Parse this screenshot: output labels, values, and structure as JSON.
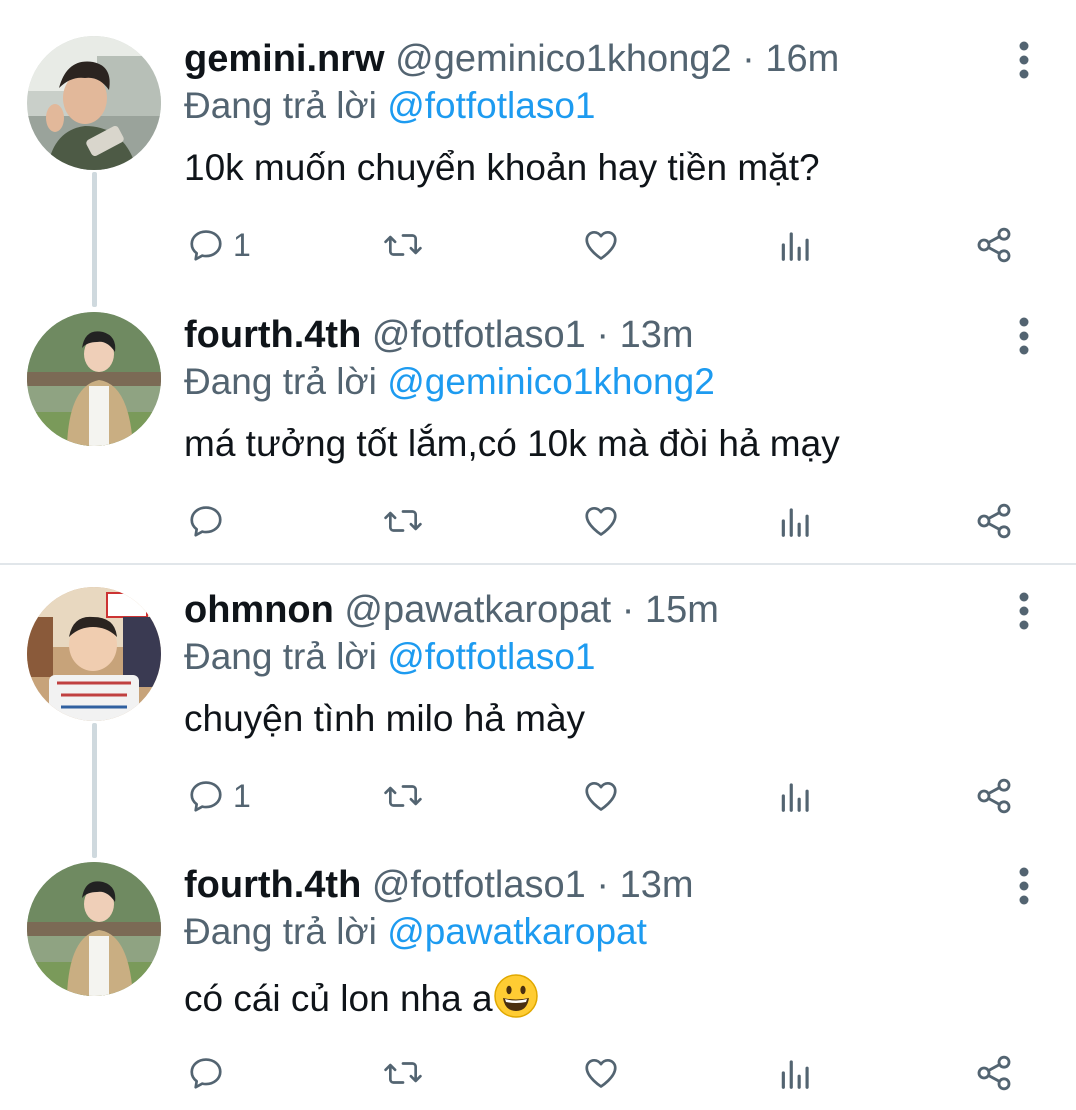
{
  "colors": {
    "text_primary": "#0f1419",
    "text_secondary": "#536471",
    "mention": "#1d9bf0",
    "thread_line": "#cfd9de",
    "divider": "#e1e6ea"
  },
  "reply_prefix": "Đang trả lời",
  "separator": "·",
  "tweets": [
    {
      "display_name": "gemini.nrw",
      "handle": "@geminico1khong2",
      "time": "16m",
      "replying_to": "@fotfotlaso1",
      "text": "10k muốn chuyển khoản hay tiền mặt?",
      "reply_count": "1",
      "avatar_icon": "profile-photo-gemini"
    },
    {
      "display_name": "fourth.4th",
      "handle": "@fotfotlaso1",
      "time": "13m",
      "replying_to": "@geminico1khong2",
      "text": "má tưởng tốt lắm,có 10k mà đòi hả mạy",
      "reply_count": "",
      "avatar_icon": "profile-photo-fourth"
    },
    {
      "display_name": "ohmnon",
      "handle": "@pawatkaropat",
      "time": "15m",
      "replying_to": "@fotfotlaso1",
      "text": "chuyện tình milo hả mày",
      "reply_count": "1",
      "avatar_icon": "profile-photo-ohmnon"
    },
    {
      "display_name": "fourth.4th",
      "handle": "@fotfotlaso1",
      "time": "13m",
      "replying_to": "@pawatkaropat",
      "text": "có cái củ lon nha a",
      "reply_count": "",
      "avatar_icon": "profile-photo-fourth",
      "emoji": "grinning-face-emoji"
    }
  ]
}
